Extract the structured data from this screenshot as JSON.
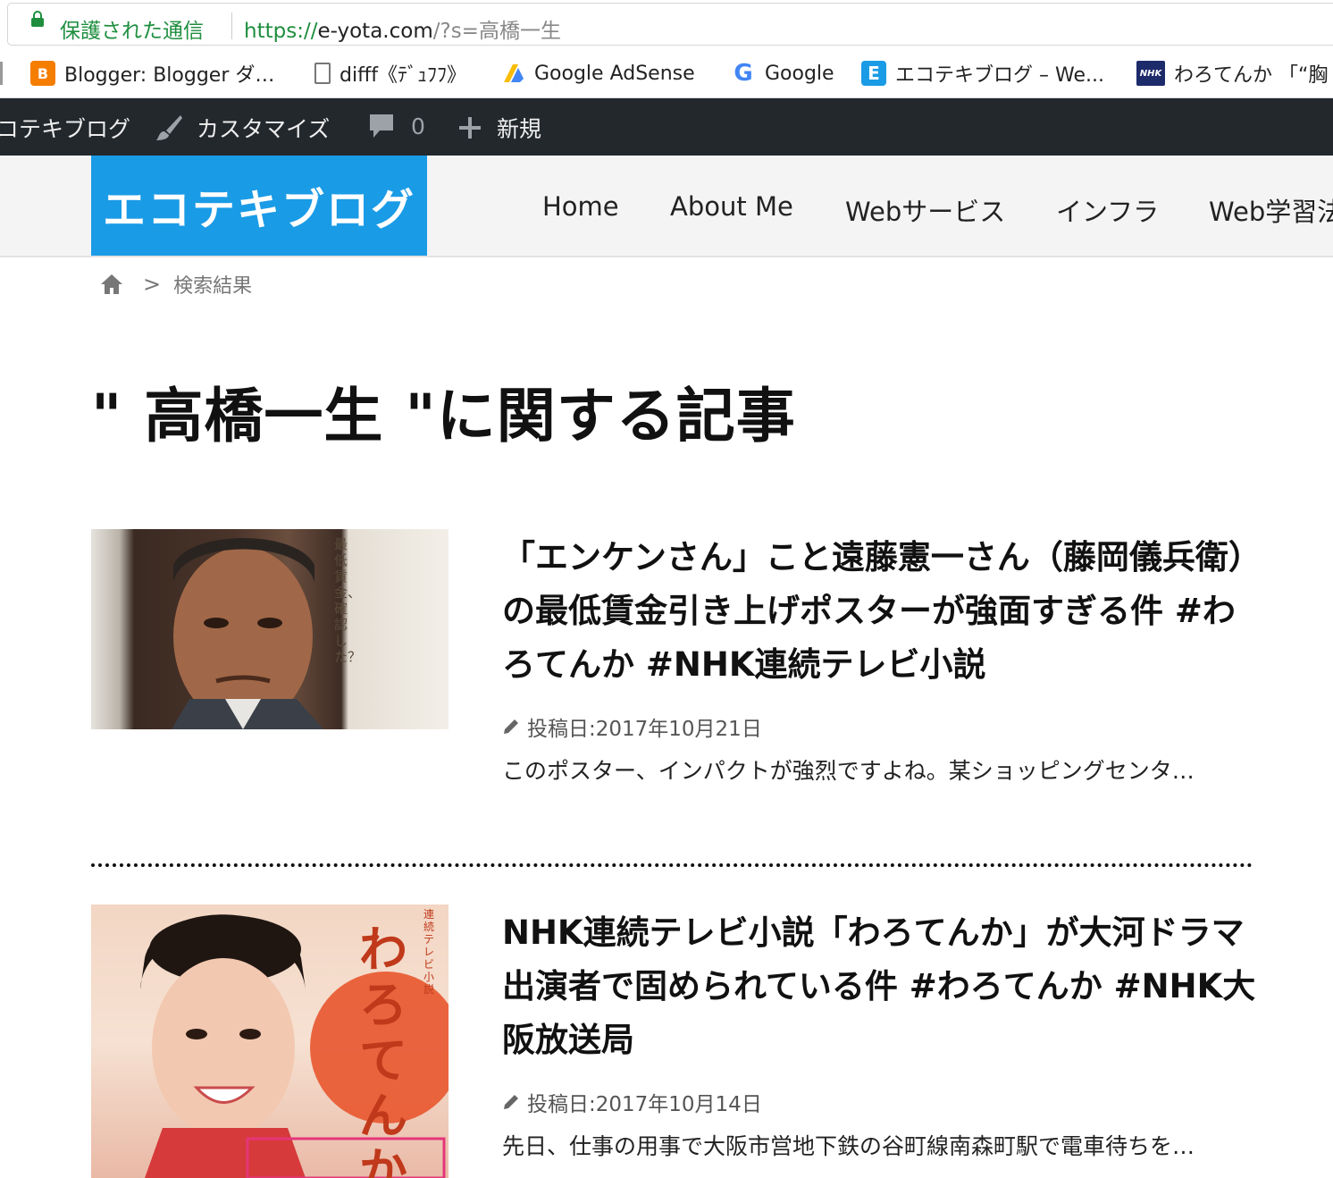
{
  "browser": {
    "secure_label": "保護された通信",
    "url_scheme": "https://",
    "url_host": "e-yota.com",
    "url_path": "/?s=高橋一生"
  },
  "bookmarks": [
    {
      "label": "Blogger: Blogger ダ…",
      "icon": "blogger-icon"
    },
    {
      "label": "difff《ﾃﾞｭﾌﾌ》",
      "icon": "document-icon"
    },
    {
      "label": "Google AdSense",
      "icon": "adsense-icon"
    },
    {
      "label": "Google",
      "icon": "google-icon"
    },
    {
      "label": "エコテキブログ – We...",
      "icon": "e-icon"
    },
    {
      "label": "わろてんか 「“胸",
      "icon": "nhk-icon"
    }
  ],
  "adminbar": {
    "site": "コテキブログ",
    "customize": "カスタマイズ",
    "comments": "0",
    "new": "新規"
  },
  "header": {
    "logo": "エコテキブログ",
    "nav": [
      "Home",
      "About Me",
      "Webサービス",
      "インフラ",
      "Web学習法"
    ]
  },
  "breadcrumb": {
    "sep": ">",
    "current": "検索結果"
  },
  "page_title": "\" 高橋一生 \"に関する記事",
  "articles": [
    {
      "title": "「エンケンさん」こと遠藤憲一さん（藤岡儀兵衛）の最低賃金引き上げポスターが強面すぎる件 #わろてんか #NHK連続テレビ小説",
      "date": "投稿日:2017年10月21日",
      "excerpt": "このポスター、インパクトが強烈ですよね。某ショッピングセンタ…",
      "thumb_text": "最低賃金、確認した？"
    },
    {
      "title": "NHK連続テレビ小説「わろてんか」が大河ドラマ出演者で固められている件 #わろてんか #NHK大阪放送局",
      "date": "投稿日:2017年10月14日",
      "excerpt": "先日、仕事の用事で大阪市営地下鉄の谷町線南森町駅で電車待ちを…",
      "thumb_text": "わろてんか",
      "thumb_small": "連続テレビ小説"
    }
  ]
}
